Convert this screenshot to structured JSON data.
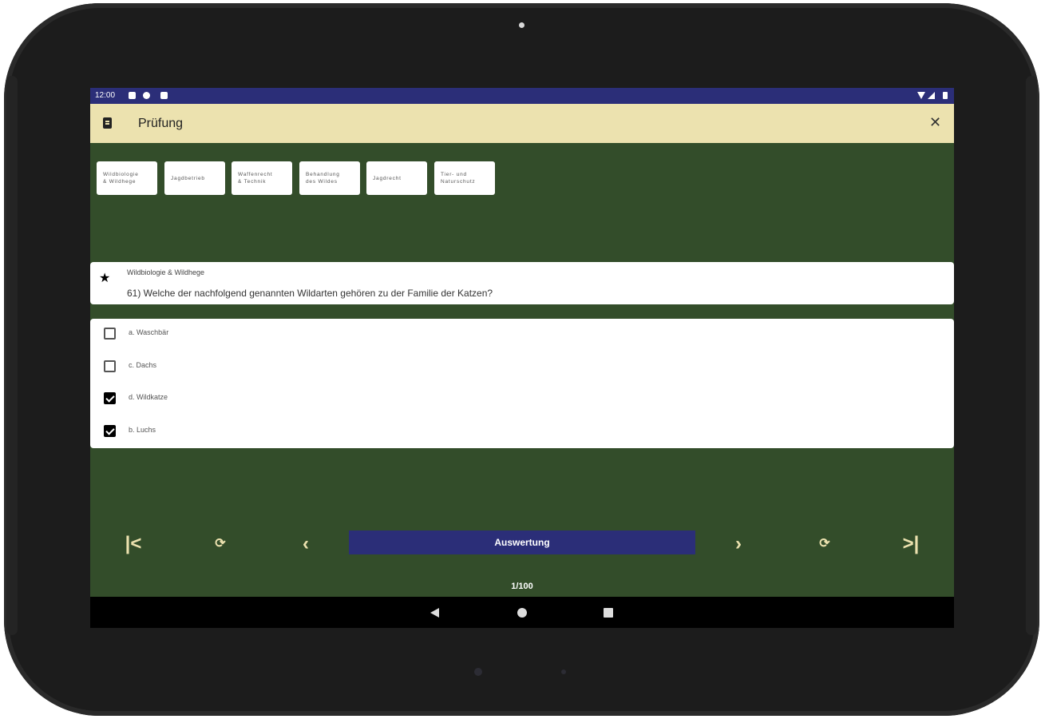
{
  "statusbar": {
    "time": "12:00"
  },
  "appbar": {
    "title": "Prüfung"
  },
  "categories": [
    {
      "label": "Wildbiologie\n& Wildhege"
    },
    {
      "label": "Jagdbetrieb"
    },
    {
      "label": "Waffenrecht\n& Technik"
    },
    {
      "label": "Behandlung\ndes Wildes"
    },
    {
      "label": "Jagdrecht"
    },
    {
      "label": "Tier- und\nNaturschutz"
    }
  ],
  "question": {
    "category": "Wildbiologie & Wildhege",
    "text": "61) Welche der nachfolgend genannten Wildarten gehören zu der Familie der Katzen?"
  },
  "answers": [
    {
      "label": "a. Waschbär",
      "checked": false
    },
    {
      "label": "c. Dachs",
      "checked": false
    },
    {
      "label": "d. Wildkatze",
      "checked": true
    },
    {
      "label": "b. Luchs",
      "checked": true
    }
  ],
  "bottom": {
    "evaluate_label": "Auswertung",
    "page_counter": "1/100"
  },
  "colors": {
    "accent": "#2b2e78",
    "background": "#334d2a",
    "appbar": "#ece2af",
    "nav_icon": "#ece2af"
  }
}
